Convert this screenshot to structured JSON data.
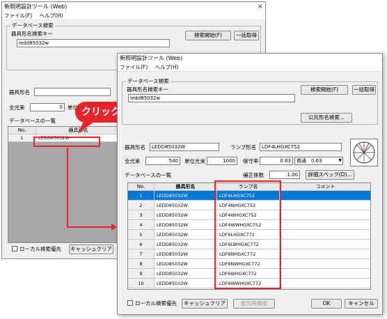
{
  "back_window": {
    "title": "新照明設計ツール (Web)",
    "close": "×",
    "menu": [
      "ファイル(F)",
      "ヘルプ(H)"
    ],
    "db_search_label": "データベース検索",
    "key_label": "器具形名検索キー",
    "key_value": "ledd85032w",
    "search_button": "検索開始(F)",
    "bulk_button": "一括取得",
    "fixture_label": "器具形名",
    "flux_label": "全光束",
    "flux_value": "0",
    "unit_label": "単位",
    "list_label": "データベースの一覧",
    "col_no": "No.",
    "col_fixture": "器具形名",
    "row1_no": "1",
    "row1_fixture": "LEDD85032W",
    "local_priority": "ローカル検索優先",
    "cache_clear": "キャッシュクリア"
  },
  "callout": {
    "text": "クリック",
    "color": "#e8242b"
  },
  "front_window": {
    "title": "新照明設計ツール (Web)",
    "menu": [
      "ファイル(F)",
      "ヘルプ(H)"
    ],
    "db_search_label": "データベース検索",
    "key_label": "器具形名検索キー",
    "key_value": "ledd85032w",
    "search_button": "検索開始(F)",
    "bulk_button": "一括取得",
    "public_search_button": "公共形名検索...",
    "fixture_label": "器具形名",
    "fixture_value": "LEDD85032W",
    "lamp_label": "ランプ形名",
    "lamp_value": "LDF4LHGXC752",
    "flux_label": "全光束",
    "flux_value": "540",
    "unit_flux_label": "単位光束",
    "unit_flux_value": "1000",
    "maint_label": "保守率",
    "maint_value": "0.63",
    "maint_select": "普通　0.63",
    "list_label": "データベースの一覧",
    "correction_label": "補正係数",
    "correction_value": "1.00",
    "detail_button": "詳細スペック(D)...",
    "headers": [
      "No.",
      "器具形名",
      "ランプ名",
      "コメント"
    ],
    "rows": [
      {
        "no": "1",
        "fixture": "LEDD85032W",
        "lamp": "LDF4LHGXC752",
        "comment": ""
      },
      {
        "no": "2",
        "fixture": "LEDD85032W",
        "lamp": "LDF4NHGXC752",
        "comment": ""
      },
      {
        "no": "3",
        "fixture": "LEDD85032W",
        "lamp": "LDF4WHGXC752",
        "comment": ""
      },
      {
        "no": "4",
        "fixture": "LEDD85032W",
        "lamp": "LDF4WWHGXC752",
        "comment": ""
      },
      {
        "no": "5",
        "fixture": "LEDD85032W",
        "lamp": "LDF6LHGXC772",
        "comment": ""
      },
      {
        "no": "6",
        "fixture": "LEDD85032W",
        "lamp": "LDF6LWHGXC772",
        "comment": ""
      },
      {
        "no": "7",
        "fixture": "LEDD85032W",
        "lamp": "LDF6NHGXC772",
        "comment": ""
      },
      {
        "no": "8",
        "fixture": "LEDD85032W",
        "lamp": "LDF6NWHGXC772",
        "comment": ""
      },
      {
        "no": "9",
        "fixture": "LEDD85032W",
        "lamp": "LDF6WHGXC772",
        "comment": ""
      },
      {
        "no": "10",
        "fixture": "LEDD85032W",
        "lamp": "LDF6WWHGXC772",
        "comment": ""
      }
    ],
    "selected_row": 0,
    "local_priority": "ローカル検索優先",
    "cache_clear": "キャッシュクリア",
    "redistribute": "配光再構成",
    "ok": "OK",
    "cancel": "キャンセル"
  },
  "colors": {
    "highlight": "#e8242b",
    "selection": "#0078d7",
    "panel": "#f0f0f0"
  }
}
